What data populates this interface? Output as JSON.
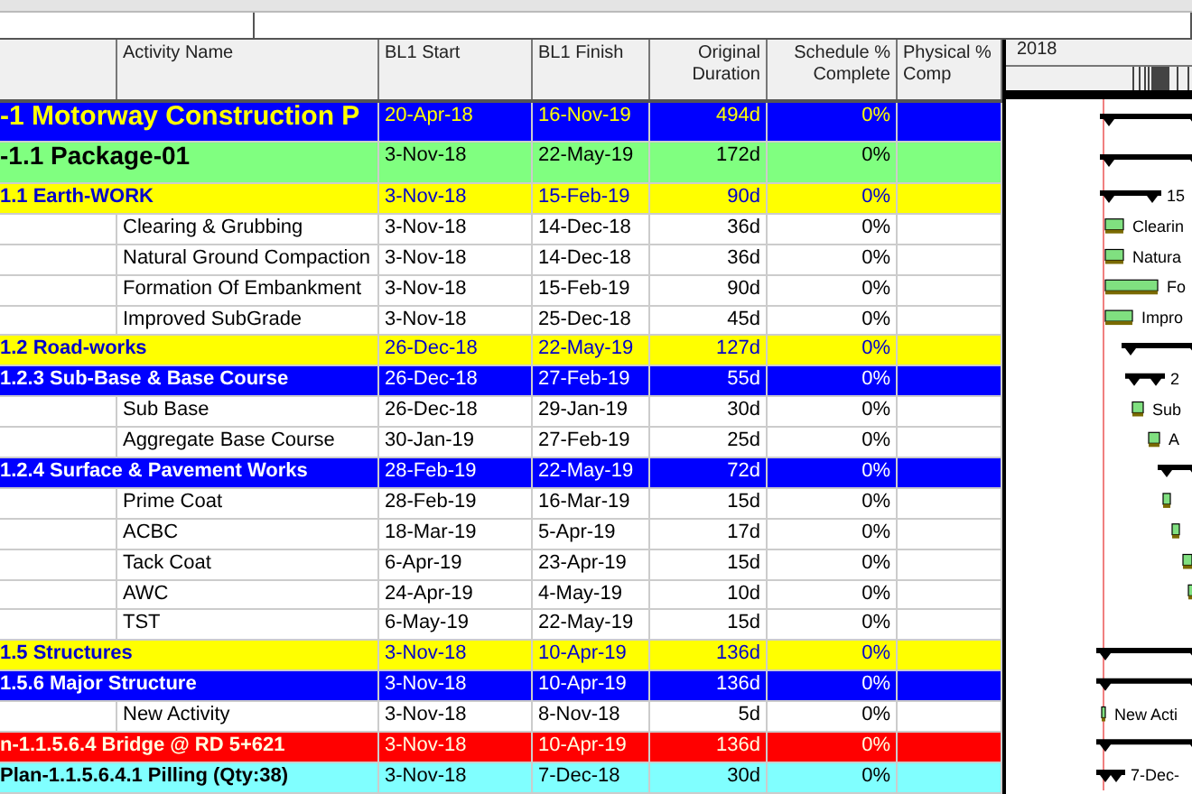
{
  "columns": [
    "Activity Name",
    "BL1 Start",
    "BL1 Finish",
    "Original Duration",
    "Schedule % Complete",
    "Physical % Comp"
  ],
  "gantt": {
    "year": "2018"
  },
  "rows": [
    {
      "kind": "project",
      "name": "-1  Motorway Construction P",
      "start": "20-Apr-18",
      "finish": "16-Nov-19",
      "duration": "494d",
      "schedule_complete": "0%"
    },
    {
      "kind": "package",
      "name": "-1.1  Package-01",
      "start": "3-Nov-18",
      "finish": "22-May-19",
      "duration": "172d",
      "schedule_complete": "0%"
    },
    {
      "kind": "group",
      "name": "1.1  Earth-WORK",
      "start": "3-Nov-18",
      "finish": "15-Feb-19",
      "duration": "90d",
      "schedule_complete": "0%",
      "bar_label": "15"
    },
    {
      "kind": "activity",
      "name": "Clearing & Grubbing",
      "start": "3-Nov-18",
      "finish": "14-Dec-18",
      "duration": "36d",
      "schedule_complete": "0%",
      "bar_label": "Clearin"
    },
    {
      "kind": "activity",
      "name": "Natural Ground Compaction",
      "start": "3-Nov-18",
      "finish": "14-Dec-18",
      "duration": "36d",
      "schedule_complete": "0%",
      "bar_label": "Natura"
    },
    {
      "kind": "activity",
      "name": "Formation Of Embankment",
      "start": "3-Nov-18",
      "finish": "15-Feb-19",
      "duration": "90d",
      "schedule_complete": "0%",
      "bar_label": "Fo"
    },
    {
      "kind": "activity",
      "name": "Improved SubGrade",
      "start": "3-Nov-18",
      "finish": "25-Dec-18",
      "duration": "45d",
      "schedule_complete": "0%",
      "bar_label": "Impro"
    },
    {
      "kind": "group",
      "name": "1.2  Road-works",
      "start": "26-Dec-18",
      "finish": "22-May-19",
      "duration": "127d",
      "schedule_complete": "0%"
    },
    {
      "kind": "subgroup",
      "name": "1.2.3  Sub-Base & Base Course",
      "start": "26-Dec-18",
      "finish": "27-Feb-19",
      "duration": "55d",
      "schedule_complete": "0%",
      "bar_label": "2"
    },
    {
      "kind": "activity",
      "name": "Sub Base",
      "start": "26-Dec-18",
      "finish": "29-Jan-19",
      "duration": "30d",
      "schedule_complete": "0%",
      "bar_label": "Sub"
    },
    {
      "kind": "activity",
      "name": "Aggregate Base Course",
      "start": "30-Jan-19",
      "finish": "27-Feb-19",
      "duration": "25d",
      "schedule_complete": "0%",
      "bar_label": "A"
    },
    {
      "kind": "subgroup",
      "name": "1.2.4  Surface & Pavement Works",
      "start": "28-Feb-19",
      "finish": "22-May-19",
      "duration": "72d",
      "schedule_complete": "0%"
    },
    {
      "kind": "activity",
      "name": "Prime Coat",
      "start": "28-Feb-19",
      "finish": "16-Mar-19",
      "duration": "15d",
      "schedule_complete": "0%"
    },
    {
      "kind": "activity",
      "name": "ACBC",
      "start": "18-Mar-19",
      "finish": "5-Apr-19",
      "duration": "17d",
      "schedule_complete": "0%"
    },
    {
      "kind": "activity",
      "name": "Tack Coat",
      "start": "6-Apr-19",
      "finish": "23-Apr-19",
      "duration": "15d",
      "schedule_complete": "0%"
    },
    {
      "kind": "activity",
      "name": "AWC",
      "start": "24-Apr-19",
      "finish": "4-May-19",
      "duration": "10d",
      "schedule_complete": "0%"
    },
    {
      "kind": "activity",
      "name": "TST",
      "start": "6-May-19",
      "finish": "22-May-19",
      "duration": "15d",
      "schedule_complete": "0%"
    },
    {
      "kind": "group",
      "name": "1.5  Structures",
      "start": "3-Nov-18",
      "finish": "10-Apr-19",
      "duration": "136d",
      "schedule_complete": "0%"
    },
    {
      "kind": "subgroup",
      "name": "1.5.6  Major Structure",
      "start": "3-Nov-18",
      "finish": "10-Apr-19",
      "duration": "136d",
      "schedule_complete": "0%"
    },
    {
      "kind": "activity",
      "name": "New Activity",
      "start": "3-Nov-18",
      "finish": "8-Nov-18",
      "duration": "5d",
      "schedule_complete": "0%",
      "bar_label": "New Acti"
    },
    {
      "kind": "bridge",
      "name": "n-1.1.5.6.4  Bridge @ RD 5+621",
      "start": "3-Nov-18",
      "finish": "10-Apr-19",
      "duration": "136d",
      "schedule_complete": "0%"
    },
    {
      "kind": "element",
      "name": "Plan-1.1.5.6.4.1  Pilling (Qty:38)",
      "start": "3-Nov-18",
      "finish": "7-Dec-18",
      "duration": "30d",
      "schedule_complete": "0%",
      "bar_label": "7-Dec-"
    }
  ]
}
